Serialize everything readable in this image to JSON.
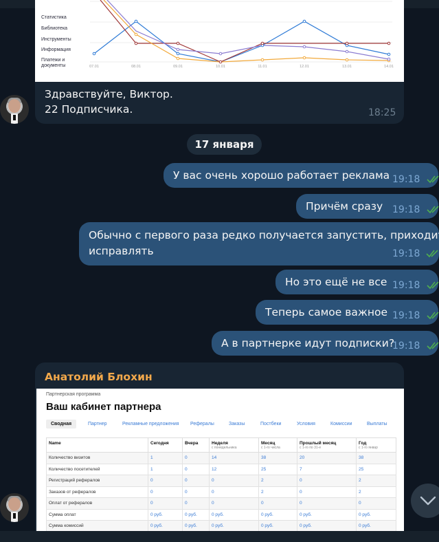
{
  "stats_screenshot": {
    "menu": [
      "Статистика",
      "Библиотека",
      "Инструменты",
      "Информация",
      "Платежи и документы"
    ],
    "x_labels": [
      "07.01",
      "08.01",
      "09.01",
      "10.01",
      "11.01",
      "12.01",
      "13.01",
      "14.01"
    ]
  },
  "greeting_message": {
    "line1": "Здравствуйте, Виктор.",
    "line2": "22 Подписчика.",
    "time": "18:25"
  },
  "date_separator": "17 января",
  "outgoing_messages": [
    {
      "text": "У вас очень хорошо работает реклама",
      "time": "19:18"
    },
    {
      "text": "Причём сразу",
      "time": "19:18"
    },
    {
      "line1": "Обычно с первого раза редко получается запустить, приходится",
      "line2": "исправлять",
      "time": "19:18"
    },
    {
      "text": "Но это ещё не все",
      "time": "19:18"
    },
    {
      "text": "Теперь самое важное",
      "time": "19:18"
    },
    {
      "text": "А в партнерке идут подписки?",
      "time": "19:18"
    }
  ],
  "partner_message": {
    "sender": "Анатолий Блохин",
    "breadcrumb": "Партнерская программа",
    "title": "Ваш кабинет партнера",
    "tabs": [
      "Сводная",
      "Партнер",
      "Рекламные предложения",
      "Рефералы",
      "Заказы",
      "Постбеки",
      "Условия",
      "Комиссии",
      "Выплаты"
    ],
    "columns": [
      {
        "label": "Name",
        "sub": ""
      },
      {
        "label": "Сегодня",
        "sub": ""
      },
      {
        "label": "Вчера",
        "sub": ""
      },
      {
        "label": "Неделя",
        "sub": "с понедельника"
      },
      {
        "label": "Месяц",
        "sub": "с 1-го числа"
      },
      {
        "label": "Прошлый месяц",
        "sub": "с 1-го по 31-е"
      },
      {
        "label": "Год",
        "sub": "с 1-го январ"
      }
    ],
    "rows": [
      [
        "Количество визитов",
        "1",
        "0",
        "14",
        "38",
        "20",
        "38"
      ],
      [
        "Количество посетителей",
        "1",
        "0",
        "12",
        "25",
        "7",
        "25"
      ],
      [
        "Регистраций рефералов",
        "0",
        "0",
        "0",
        "2",
        "0",
        "2"
      ],
      [
        "Заказов от рефералов",
        "0",
        "0",
        "0",
        "2",
        "0",
        "2"
      ],
      [
        "Оплат от рефералов",
        "0",
        "0",
        "0",
        "0",
        "0",
        "0"
      ],
      [
        "Сумма оплат",
        "0 руб.",
        "0 руб.",
        "0 руб.",
        "0 руб.",
        "0 руб.",
        "0 руб."
      ],
      [
        "Сумма комиссий",
        "0 руб.",
        "0 руб.",
        "0 руб.",
        "0 руб.",
        "0 руб.",
        "0 руб."
      ]
    ]
  },
  "colors": {
    "background": "#0e1621",
    "incoming_bubble": "#182533",
    "outgoing_bubble": "#2b5278",
    "sender_name": "#f2a84b",
    "read_ticks": "#4fae4e",
    "line_blue": "#2f7bd6",
    "line_darkred": "#a03838",
    "line_orange": "#f2a93b",
    "line_purple": "#8a7bd0"
  },
  "icons": {
    "read_status": "double-check-icon",
    "scroll_down": "chevron-down-icon"
  }
}
